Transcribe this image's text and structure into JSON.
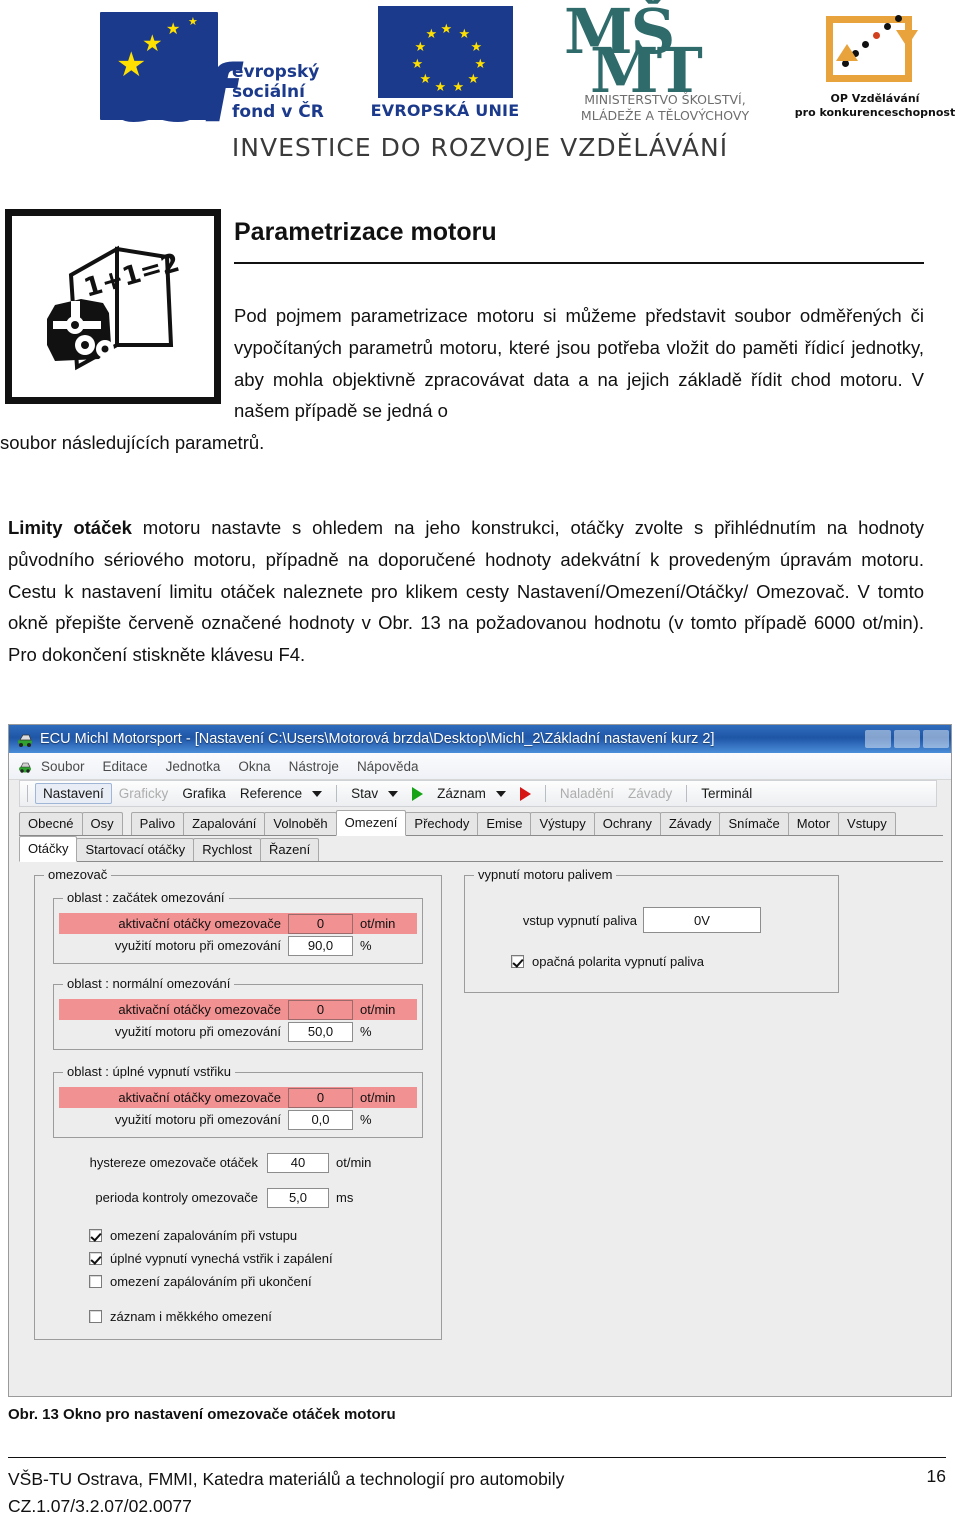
{
  "header": {
    "logos": [
      {
        "name": "esf",
        "text_lines": [
          "evropský",
          "sociální",
          "fond v ČR"
        ]
      },
      {
        "name": "eu",
        "text": "EVROPSKÁ UNIE"
      },
      {
        "name": "msmt",
        "mark_line1": "MŠ",
        "mark_line2": "MT",
        "caption_line1": "MINISTERSTVO ŠKOLSTVÍ,",
        "caption_line2": "MLÁDEŽE A TĚLOVÝCHOVY"
      },
      {
        "name": "op-vzdelavani",
        "caption_line1": "OP Vzdělávání",
        "caption_line2": "pro konkurenceschopnost"
      }
    ],
    "tagline": "INVESTICE DO ROZVOJE VZDĚLÁVÁNÍ"
  },
  "title": "Parametrizace motoru",
  "paragraphs": {
    "p1_main": "Pod pojmem parametrizace motoru si můžeme představit soubor odměřených či vypočítaných parametrů motoru, které jsou potřeba vložit do paměti řídicí jednotky, aby mohla objektivně zpracovávat data a na jejich základě řídit chod motoru. V našem případě se jedná o",
    "p1_tail": "soubor následujících parametrů.",
    "p2_bold": "Limity otáček",
    "p2_rest": " motoru nastavte s ohledem na jeho konstrukci, otáčky zvolte s přihlédnutím na hodnoty původního sériového motoru, případně na doporučené hodnoty adekvátní k provedeným úpravám motoru. Cestu k nastavení limitu otáček naleznete pro klikem cesty Nastavení/Omezení/Otáčky/ Omezovač. V tomto okně přepište červeně označené hodnoty v Obr. 13 na požadovanou hodnotu (v tomto případě 6000 ot/min). Pro dokončení stiskněte klávesu F4."
  },
  "app": {
    "title": "ECU Michl Motorsport - [Nastavení C:\\Users\\Motorová brzda\\Desktop\\Michl_2\\Základní nastavení kurz 2]",
    "menu": [
      "Soubor",
      "Editace",
      "Jednotka",
      "Okna",
      "Nástroje",
      "Nápověda"
    ],
    "toolbar": [
      {
        "label": "Nastavení",
        "state": "active"
      },
      {
        "label": "Graficky",
        "state": "disabled"
      },
      {
        "label": "Grafika",
        "state": "normal"
      },
      {
        "label": "Reference",
        "state": "normal",
        "dropdown": true
      },
      {
        "label": "Stav",
        "state": "normal",
        "dropdown": true
      },
      {
        "label": "Záznam",
        "state": "normal",
        "dropdown": true
      },
      {
        "label": "Naladění",
        "state": "disabled"
      },
      {
        "label": "Závady",
        "state": "disabled"
      },
      {
        "label": "Terminál",
        "state": "normal"
      }
    ],
    "tabs_row1": [
      "Obecné",
      "Osy",
      "Palivo",
      "Zapalování",
      "Volnoběh",
      "Omezení",
      "Přechody",
      "Emise",
      "Výstupy",
      "Ochrany",
      "Závady",
      "Snímače",
      "Motor",
      "Vstupy"
    ],
    "tabs_row1_selected": "Omezení",
    "tabs_row2": [
      "Otáčky",
      "Startovací otáčky",
      "Rychlost",
      "Řazení"
    ],
    "tabs_row2_selected": "Otáčky",
    "limiter_group_title": "omezovač",
    "sections": [
      {
        "title": "oblast : začátek omezování",
        "rows": [
          {
            "label": "aktivační otáčky omezovače",
            "value": "0",
            "unit": "ot/min",
            "highlight": true
          },
          {
            "label": "využití motoru při omezování",
            "value": "90,0",
            "unit": "%",
            "highlight": false
          }
        ]
      },
      {
        "title": "oblast : normální omezování",
        "rows": [
          {
            "label": "aktivační otáčky omezovače",
            "value": "0",
            "unit": "ot/min",
            "highlight": true
          },
          {
            "label": "využití motoru při omezování",
            "value": "50,0",
            "unit": "%",
            "highlight": false
          }
        ]
      },
      {
        "title": "oblast : úplné vypnutí vstřiku",
        "rows": [
          {
            "label": "aktivační otáčky omezovače",
            "value": "0",
            "unit": "ot/min",
            "highlight": true
          },
          {
            "label": "využití motoru při omezování",
            "value": "0,0",
            "unit": "%",
            "highlight": false
          }
        ]
      }
    ],
    "extra_fields": [
      {
        "label": "hystereze omezovače otáček",
        "value": "40",
        "unit": "ot/min"
      },
      {
        "label": "perioda kontroly omezovače",
        "value": "5,0",
        "unit": "ms"
      }
    ],
    "checkboxes": [
      {
        "label": "omezení zapalováním při vstupu",
        "checked": true
      },
      {
        "label": "úplné vypnutí vynechá vstřik i zapálení",
        "checked": true
      },
      {
        "label": "omezení zapálováním při ukončení",
        "checked": false
      },
      {
        "label": "záznam i měkkého omezení",
        "checked": false
      }
    ],
    "right_group": {
      "title": "vypnutí motoru palivem",
      "field_label": "vstup vypnutí paliva",
      "field_value": "0V",
      "checkbox_label": "opačná polarita vypnutí paliva",
      "checkbox_checked": true
    }
  },
  "figure_caption": "Obr. 13 Okno pro nastavení omezovače otáček motoru",
  "footer": {
    "line1": "VŠB-TU Ostrava, FMMI, Katedra materiálů a technologií pro automobily",
    "line2": "CZ.1.07/3.2.07/02.0077",
    "page": "16"
  },
  "colors": {
    "highlight_red": "#F19191",
    "eu_blue": "#1B3A8C",
    "msmt_teal": "#2F6B6B",
    "op_orange": "#E8A33D",
    "titlebar_blue": "#1F56A6"
  }
}
